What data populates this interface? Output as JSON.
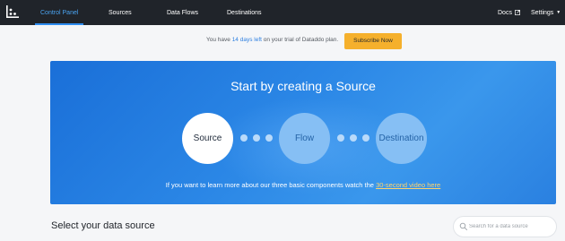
{
  "nav": {
    "items": [
      {
        "label": "Control Panel",
        "active": true
      },
      {
        "label": "Sources",
        "active": false
      },
      {
        "label": "Data Flows",
        "active": false
      },
      {
        "label": "Destinations",
        "active": false
      }
    ],
    "docs_label": "Docs",
    "settings_label": "Settings"
  },
  "trial": {
    "prefix": "You have",
    "days": "14 days left",
    "suffix": "on your trial of Dataddo plan.",
    "button_label": "Subscribe Now"
  },
  "hero": {
    "title": "Start by creating a Source",
    "steps": [
      "Source",
      "Flow",
      "Destination"
    ],
    "note_text": "If you want to learn more about our three basic components watch the",
    "note_link": "30-second video here"
  },
  "main": {
    "section_title": "Select your data source",
    "search_placeholder": "Search for a data source"
  },
  "colors": {
    "nav_bg": "#20242a",
    "accent": "#2d8cf0",
    "subscribe": "#f5b02c",
    "hero": "#2b87e6",
    "link": "#ffd36b"
  }
}
